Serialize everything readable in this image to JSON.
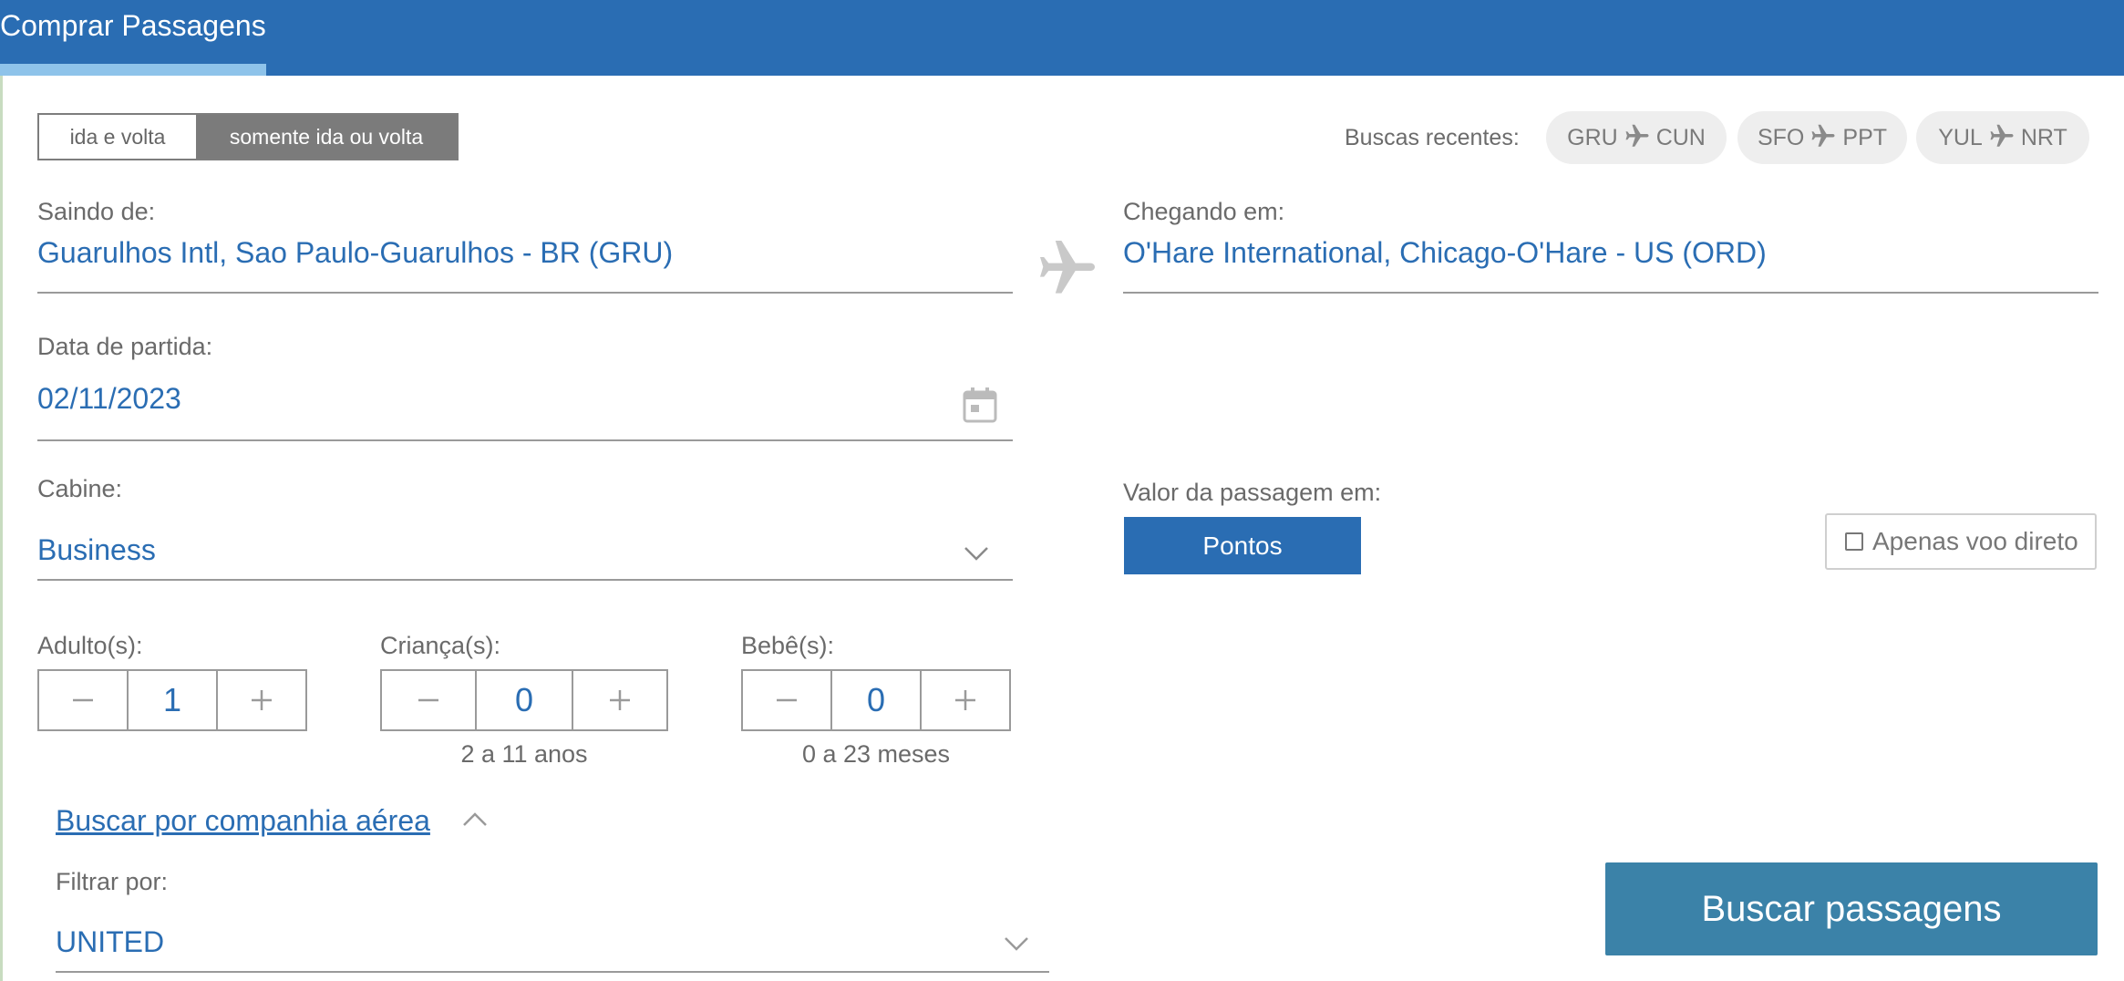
{
  "header": {
    "title": "Comprar Passagens"
  },
  "trip_type": {
    "round_trip_label": "ida e volta",
    "one_way_label": "somente ida ou volta",
    "selected": "somente ida ou volta"
  },
  "recent_searches": {
    "label": "Buscas recentes:",
    "items": [
      {
        "from": "GRU",
        "to": "CUN"
      },
      {
        "from": "SFO",
        "to": "PPT"
      },
      {
        "from": "YUL",
        "to": "NRT"
      }
    ]
  },
  "origin": {
    "label": "Saindo de:",
    "value": "Guarulhos Intl, Sao Paulo-Guarulhos - BR (GRU)"
  },
  "destination": {
    "label": "Chegando em:",
    "value": "O'Hare International, Chicago-O'Hare - US (ORD)"
  },
  "departure_date": {
    "label": "Data de partida:",
    "value": "02/11/2023"
  },
  "cabin": {
    "label": "Cabine:",
    "value": "Business"
  },
  "fare": {
    "label": "Valor da passagem em:",
    "button_label": "Pontos"
  },
  "direct_only": {
    "label": "Apenas voo direto",
    "checked": false
  },
  "passengers": {
    "adults": {
      "label": "Adulto(s):",
      "value": "1",
      "hint": ""
    },
    "children": {
      "label": "Criança(s):",
      "value": "0",
      "hint": "2 a 11 anos"
    },
    "infants": {
      "label": "Bebê(s):",
      "value": "0",
      "hint": "0 a 23 meses"
    }
  },
  "airline_search": {
    "link_label": "Buscar por companhia aérea",
    "filter_label": "Filtrar por:",
    "filter_value": "UNITED"
  },
  "search_button_label": "Buscar passagens",
  "colors": {
    "header": "#2a6db3",
    "accent_blue": "#2a6db3",
    "search_button": "#3b82a8",
    "toggle_selected": "#7b7b7b",
    "chip_bg": "#eeeeee"
  },
  "icons": {
    "recent_arrow": "plane-icon",
    "route": "plane-icon",
    "date": "calendar-icon",
    "select": "chevron-down-icon",
    "collapse": "chevron-up-icon",
    "decrement": "minus-icon",
    "increment": "plus-icon"
  }
}
